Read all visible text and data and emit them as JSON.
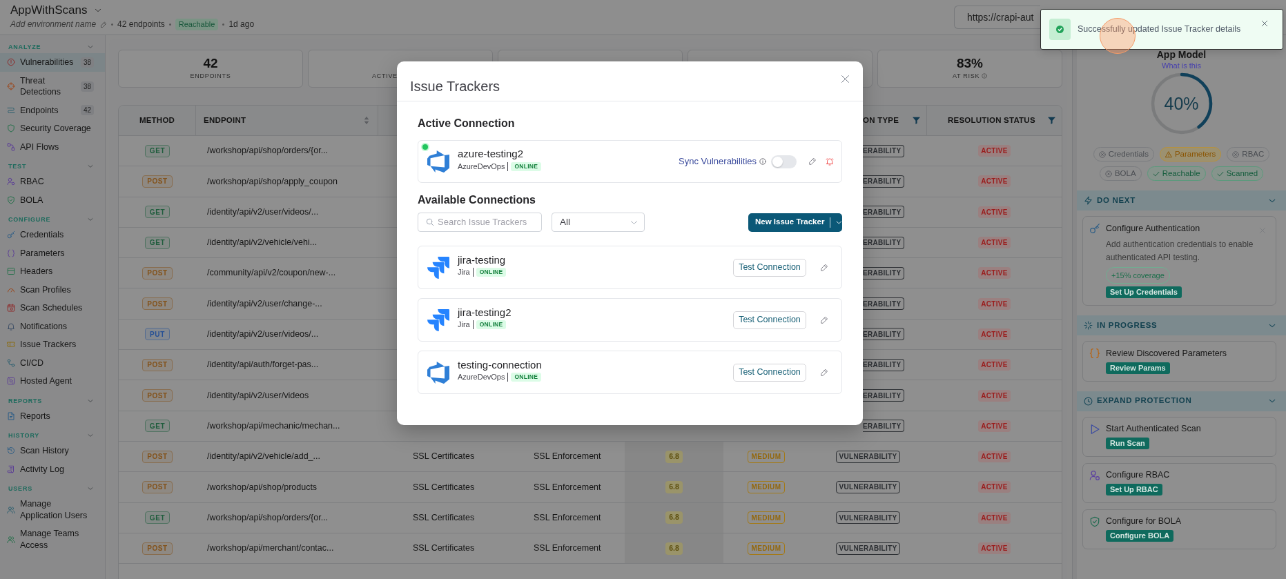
{
  "header": {
    "title": "AppWithScans",
    "environment_placeholder": "Add environment name",
    "endpoint_count": "42 endpoints",
    "status": "Reachable",
    "last_scan": "1d ago",
    "url": "https://crapi-aut"
  },
  "sidebar": {
    "sections": [
      {
        "label": "ANALYZE",
        "expanded": true,
        "items": [
          {
            "label": "Vulnerabilities",
            "count": "38",
            "selected": true
          },
          {
            "label": "Threat Detections",
            "count": "38",
            "selected": false
          },
          {
            "label": "Endpoints",
            "count": "42",
            "selected": false
          },
          {
            "label": "Security Coverage",
            "selected": false
          },
          {
            "label": "API Flows",
            "selected": false
          }
        ]
      },
      {
        "label": "TEST",
        "expanded": true,
        "items": [
          {
            "label": "RBAC",
            "selected": false
          },
          {
            "label": "BOLA",
            "selected": false
          }
        ]
      },
      {
        "label": "CONFIGURE",
        "expanded": true,
        "items": [
          {
            "label": "Credentials",
            "selected": false
          },
          {
            "label": "Parameters",
            "selected": false
          },
          {
            "label": "Headers",
            "selected": false
          },
          {
            "label": "Scan Profiles",
            "selected": false
          },
          {
            "label": "Scan Schedules",
            "selected": false
          },
          {
            "label": "Notifications",
            "selected": false
          },
          {
            "label": "Issue Trackers",
            "selected": false
          },
          {
            "label": "CI/CD",
            "selected": false
          },
          {
            "label": "Hosted Agent",
            "selected": false
          }
        ]
      },
      {
        "label": "REPORTS",
        "expanded": true,
        "items": [
          {
            "label": "Reports",
            "selected": false
          }
        ]
      },
      {
        "label": "HISTORY",
        "expanded": true,
        "items": [
          {
            "label": "Scan History",
            "selected": false
          },
          {
            "label": "Activity Log",
            "selected": false
          }
        ]
      },
      {
        "label": "USERS",
        "expanded": true,
        "items": [
          {
            "label": "Manage Application Users",
            "selected": false
          },
          {
            "label": "Manage Teams Access",
            "selected": false
          }
        ]
      }
    ]
  },
  "stats": [
    {
      "kind": "stat",
      "value": "42",
      "label": "ENDPOINTS"
    },
    {
      "kind": "stat",
      "label": "ACTIVE"
    },
    {
      "kind": "covered"
    },
    {
      "kind": "covered"
    },
    {
      "kind": "stat",
      "value": "83%",
      "label": "AT RISK",
      "info": true
    }
  ],
  "table": {
    "columns": [
      {
        "kind": "header",
        "label": "METHOD"
      },
      {
        "kind": "header",
        "label": "ENDPOINT",
        "sortable": true
      },
      {
        "kind": "covered"
      },
      {
        "kind": "covered"
      },
      {
        "kind": "covered"
      },
      {
        "kind": "covered"
      },
      {
        "kind": "header",
        "label": "ON TYPE",
        "filterable": true
      },
      {
        "kind": "header",
        "label": "RESOLUTION STATUS",
        "filterable": true
      }
    ],
    "rows": [
      {
        "method": {
          "label": "GET",
          "color": "#1d5c3b"
        },
        "endpoint": "/workshop/api/shop/orders/{or...",
        "type": {
          "label": "ERABILITY",
          "clipped": true
        },
        "status": "ACTIVE"
      },
      {
        "method": {
          "label": "POST",
          "color": "#83521a"
        },
        "endpoint": "/workshop/api/shop/apply_coupon",
        "type": {
          "label": "ERABILITY",
          "clipped": true
        },
        "status": "ACTIVE"
      },
      {
        "method": {
          "label": "GET",
          "color": "#1d5c3b"
        },
        "endpoint": "/identity/api/v2/user/videos/...",
        "type": {
          "label": "ERABILITY",
          "clipped": true
        },
        "status": "ACTIVE"
      },
      {
        "method": {
          "label": "GET",
          "color": "#1d5c3b"
        },
        "endpoint": "/identity/api/v2/vehicle/vehi...",
        "type": {
          "label": "ERABILITY",
          "clipped": true
        },
        "status": "ACTIVE"
      },
      {
        "method": {
          "label": "POST",
          "color": "#83521a"
        },
        "endpoint": "/community/api/v2/coupon/new-...",
        "type": {
          "label": "ERABILITY",
          "clipped": true
        },
        "status": "ACTIVE"
      },
      {
        "method": {
          "label": "POST",
          "color": "#83521a"
        },
        "endpoint": "/identity/api/v2/user/change-...",
        "type": {
          "label": "ERABILITY",
          "clipped": true
        },
        "status": "ACTIVE"
      },
      {
        "method": {
          "label": "PUT",
          "color": "#244f95"
        },
        "endpoint": "/identity/api/v2/user/videos/...",
        "type": {
          "label": "ERABILITY",
          "clipped": true
        },
        "status": "ACTIVE"
      },
      {
        "method": {
          "label": "POST",
          "color": "#83521a"
        },
        "endpoint": "/identity/api/auth/forget-pas...",
        "type": {
          "label": "ERABILITY",
          "clipped": true
        },
        "status": "ACTIVE"
      },
      {
        "method": {
          "label": "POST",
          "color": "#83521a"
        },
        "endpoint": "/identity/api/v2/user/videos",
        "type": {
          "label": "ERABILITY",
          "clipped": true
        },
        "status": "ACTIVE"
      },
      {
        "method": {
          "label": "GET",
          "color": "#1d5c3b"
        },
        "endpoint": "/workshop/api/mechanic/mechan...",
        "type": {
          "label": "ERABILITY",
          "clipped": true
        },
        "status": "ACTIVE"
      },
      {
        "method": {
          "label": "POST",
          "color": "#83521a"
        },
        "endpoint": "/identity/api/v2/vehicle/add_...",
        "category": "SSL Certificates",
        "check": "SSL Enforcement",
        "score": "6.8",
        "severity": "MEDIUM",
        "type": {
          "label": "VULNERABILITY",
          "clipped": false
        },
        "status": "ACTIVE"
      },
      {
        "method": {
          "label": "POST",
          "color": "#83521a"
        },
        "endpoint": "/workshop/api/shop/products",
        "category": "SSL Certificates",
        "check": "SSL Enforcement",
        "score": "6.8",
        "severity": "MEDIUM",
        "type": {
          "label": "VULNERABILITY",
          "clipped": false
        },
        "status": "ACTIVE"
      },
      {
        "method": {
          "label": "GET",
          "color": "#1d5c3b"
        },
        "endpoint": "/workshop/api/shop/orders/{or...",
        "category": "SSL Certificates",
        "check": "SSL Enforcement",
        "score": "6.8",
        "severity": "MEDIUM",
        "type": {
          "label": "VULNERABILITY",
          "clipped": false
        },
        "status": "ACTIVE"
      },
      {
        "method": {
          "label": "POST",
          "color": "#83521a"
        },
        "endpoint": "/workshop/api/merchant/contac...",
        "category": "SSL Certificates",
        "check": "SSL Enforcement",
        "score": "6.8",
        "severity": "MEDIUM",
        "type": {
          "label": "VULNERABILITY",
          "clipped": false
        },
        "status": "ACTIVE"
      }
    ]
  },
  "app_model": {
    "title": "App Model",
    "help_link": "What is this",
    "percent": "40%",
    "level": 0.4,
    "chips": [
      {
        "label": "Credentials",
        "kind": "missing"
      },
      {
        "label": "Parameters",
        "kind": "warning"
      },
      {
        "label": "RBAC",
        "kind": "missing"
      },
      {
        "label": "BOLA",
        "kind": "missing"
      },
      {
        "label": "Reachable",
        "kind": "done"
      },
      {
        "label": "Scanned",
        "kind": "done"
      }
    ]
  },
  "guidance": [
    {
      "title": "DO NEXT",
      "expanded": true,
      "cards": [
        {
          "title": "Configure Authentication",
          "description": "Add authentication credentials to enable authenticated API testing.",
          "tag": "+15% coverage",
          "action": "Set Up Credentials",
          "dismissible": true
        }
      ]
    },
    {
      "title": "IN PROGRESS",
      "expanded": true,
      "cards": [
        {
          "title": "Review Discovered Parameters",
          "action": "Review Params"
        }
      ]
    },
    {
      "title": "EXPAND PROTECTION",
      "expanded": true,
      "cards": [
        {
          "title": "Start Authenticated Scan",
          "action": "Run Scan"
        },
        {
          "title": "Configure RBAC",
          "action": "Set Up RBAC"
        },
        {
          "title": "Configure for BOLA",
          "action": "Configure BOLA"
        }
      ]
    }
  ],
  "dialog": {
    "title": "Issue Trackers",
    "active_heading": "Active Connection",
    "active_connection": {
      "name": "azure-testing2",
      "provider": "AzureDevOps",
      "kind": "azure",
      "status": "ONLINE",
      "live": true,
      "sync_label": "Sync Vulnerabilities",
      "sync_on": false
    },
    "available_heading": "Available Connections",
    "search": {
      "placeholder": "Search Issue Trackers"
    },
    "filter": {
      "value": "All"
    },
    "new_button": "New Issue Tracker",
    "connections": [
      {
        "name": "jira-testing",
        "provider": "Jira",
        "kind": "jira",
        "status": "ONLINE",
        "action": "Test Connection"
      },
      {
        "name": "jira-testing2",
        "provider": "Jira",
        "kind": "jira",
        "status": "ONLINE",
        "action": "Test Connection"
      },
      {
        "name": "testing-connection",
        "provider": "AzureDevOps",
        "kind": "azure",
        "status": "ONLINE",
        "action": "Test Connection"
      }
    ]
  },
  "toast": {
    "message": "Successfully updated Issue Tracker details",
    "kind": "success"
  },
  "click_marker": true
}
